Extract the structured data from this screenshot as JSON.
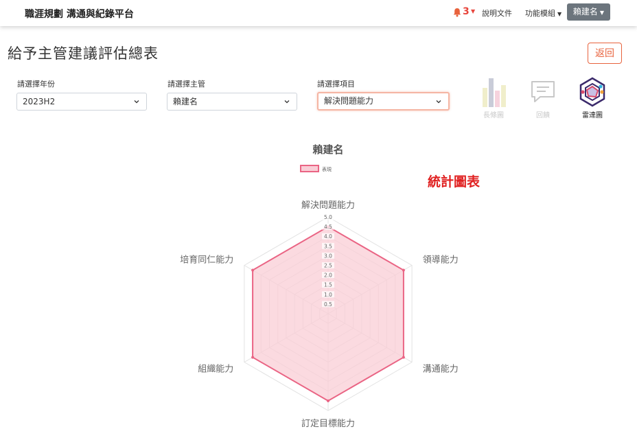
{
  "navbar": {
    "brand": "職涯規劃 溝通與紀錄平台",
    "notification_count": "3",
    "docs_label": "說明文件",
    "modules_label": "功能模組",
    "user_label": "賴建名"
  },
  "header": {
    "title": "給予主管建議評估總表",
    "back_label": "返回"
  },
  "filters": {
    "year": {
      "label": "請選擇年份",
      "value": "2023H2"
    },
    "manager": {
      "label": "請選擇主管",
      "value": "賴建名"
    },
    "item": {
      "label": "請選擇項目",
      "value": "解決問題能力"
    }
  },
  "chart_types": [
    {
      "label": "長條圖",
      "icon": "bar-chart-icon",
      "active": false
    },
    {
      "label": "回饋",
      "icon": "feedback-icon",
      "active": false
    },
    {
      "label": "雷達圖",
      "icon": "radar-chart-icon",
      "active": true
    }
  ],
  "annotation": "統計圖表",
  "colors": {
    "accent": "#e8623c",
    "series_line": "#ea6484",
    "series_fill": "#f9cdd6",
    "annotation": "#e02020"
  },
  "chart_data": {
    "type": "radar",
    "title": "賴建名",
    "categories": [
      "解決問題能力",
      "領導能力",
      "溝通能力",
      "訂定目標能力",
      "組織能力",
      "培育同仁能力"
    ],
    "series": [
      {
        "name": "表現",
        "values": [
          4.5,
          4.5,
          4.5,
          4.5,
          4.5,
          4.5
        ]
      }
    ],
    "r_range": [
      0,
      5
    ],
    "r_ticks": [
      "0.5",
      "1.0",
      "1.5",
      "2.0",
      "2.5",
      "3.0",
      "3.5",
      "4.0",
      "4.5",
      "5.0"
    ],
    "grid": true,
    "legend": "top"
  }
}
